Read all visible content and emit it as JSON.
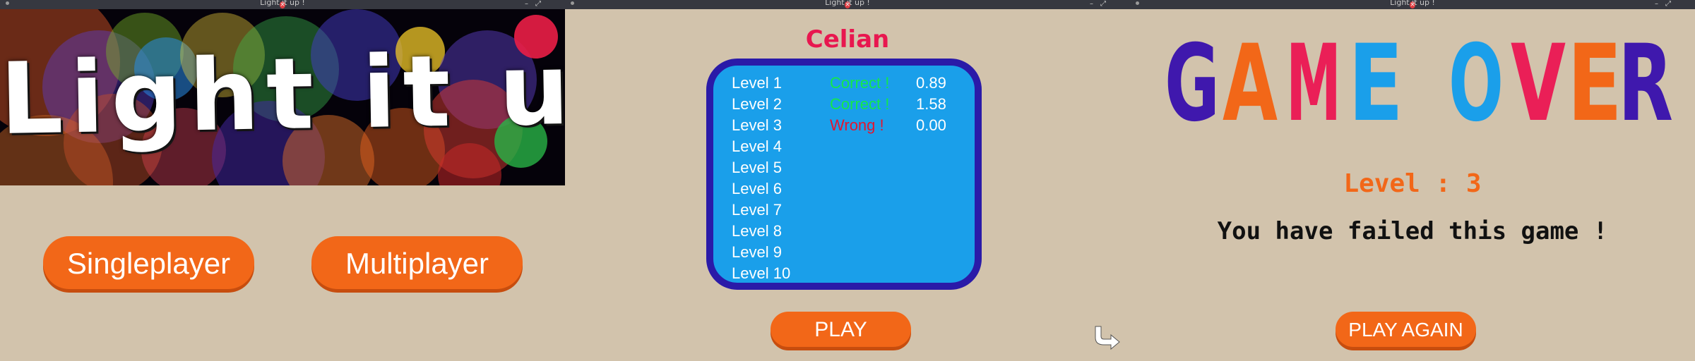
{
  "window_title": "Light it up !",
  "titlebar": {
    "minimize": "–",
    "maximize": "⤢",
    "close": "×"
  },
  "menu": {
    "banner_title": "Light it up !",
    "singleplayer_label": "Singleplayer",
    "multiplayer_label": "Multiplayer"
  },
  "scoreboard": {
    "player_name": "Celian",
    "rows": [
      {
        "level": "Level 1",
        "status": "Correct !",
        "time": "0.89"
      },
      {
        "level": "Level 2",
        "status": "Correct !",
        "time": "1.58"
      },
      {
        "level": "Level 3",
        "status": "Wrong !",
        "time": "0.00"
      },
      {
        "level": "Level 4",
        "status": "",
        "time": ""
      },
      {
        "level": "Level 5",
        "status": "",
        "time": ""
      },
      {
        "level": "Level 6",
        "status": "",
        "time": ""
      },
      {
        "level": "Level 7",
        "status": "",
        "time": ""
      },
      {
        "level": "Level 8",
        "status": "",
        "time": ""
      },
      {
        "level": "Level 9",
        "status": "",
        "time": ""
      },
      {
        "level": "Level 10",
        "status": "",
        "time": ""
      }
    ],
    "play_label": "PLAY"
  },
  "game_over": {
    "title": "GAME OVER",
    "letter_colors": [
      "#3f18ad",
      "#f26718",
      "#ea1f57",
      "#1a9fea",
      "#1a9fea",
      "#ea1f57",
      "#f26718",
      "#3f18ad"
    ],
    "level_text": "Level : 3",
    "failed_text": "You have failed this game !",
    "play_again_label": "PLAY AGAIN"
  },
  "colors": {
    "background": "#d2c3ac",
    "button_orange": "#f26718",
    "panel_blue": "#1a9fea",
    "panel_border": "#2a1aa8",
    "correct_green": "#13e84a",
    "wrong_red": "#e3152f",
    "name_pink": "#e8174f"
  }
}
